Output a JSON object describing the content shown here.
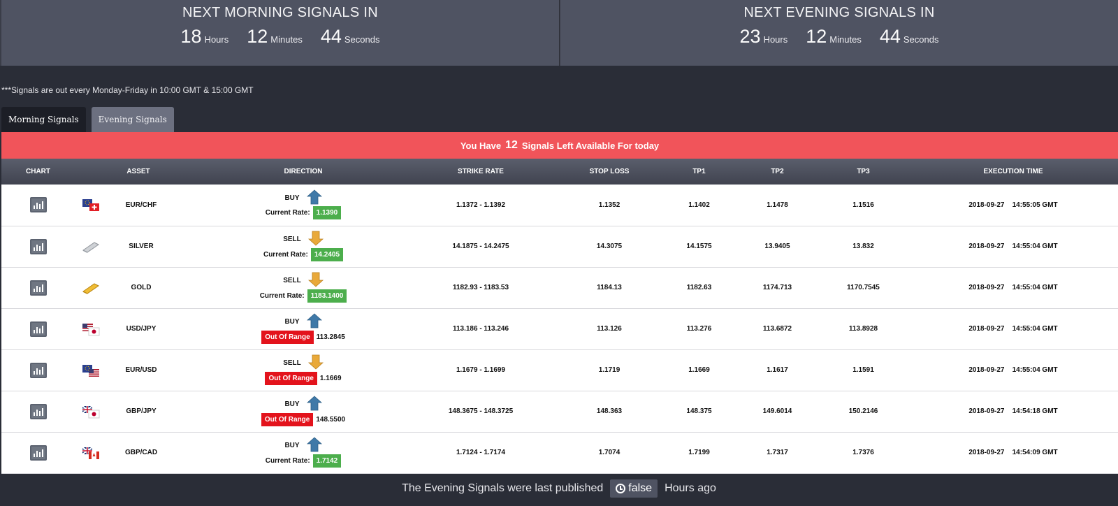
{
  "countdown": {
    "morning": {
      "title": "NEXT MORNING SIGNALS IN",
      "hours": "18",
      "hours_label": "Hours",
      "minutes": "12",
      "minutes_label": "Minutes",
      "seconds": "44",
      "seconds_label": "Seconds"
    },
    "evening": {
      "title": "NEXT EVENING SIGNALS IN",
      "hours": "23",
      "hours_label": "Hours",
      "minutes": "12",
      "minutes_label": "Minutes",
      "seconds": "44",
      "seconds_label": "Seconds"
    }
  },
  "note": "***Signals are out every Monday-Friday in 10:00 GMT & 15:00 GMT",
  "tabs": [
    {
      "label": "Morning Signals"
    },
    {
      "label": "Evening Signals"
    }
  ],
  "banner": {
    "prefix": "You Have",
    "count": "12",
    "suffix": "Signals Left Available For today"
  },
  "table": {
    "headers": [
      "CHART",
      "ASSET",
      "DIRECTION",
      "STRIKE RATE",
      "STOP LOSS",
      "TP1",
      "TP2",
      "TP3",
      "EXECUTION TIME"
    ],
    "rows": [
      {
        "asset": "EUR/CHF",
        "flag": "eur-chf-flag-icon",
        "direction": "BUY",
        "status": "current",
        "rate_label": "Current Rate:",
        "rate": "1.1390",
        "strike": "1.1372 - 1.1392",
        "stop": "1.1352",
        "tp1": "1.1402",
        "tp2": "1.1478",
        "tp3": "1.1516",
        "date": "2018-09-27",
        "time": "14:55:05 GMT"
      },
      {
        "asset": "SILVER",
        "flag": "silver-bar-icon",
        "direction": "SELL",
        "status": "current",
        "rate_label": "Current Rate:",
        "rate": "14.2405",
        "strike": "14.1875 - 14.2475",
        "stop": "14.3075",
        "tp1": "14.1575",
        "tp2": "13.9405",
        "tp3": "13.832",
        "date": "2018-09-27",
        "time": "14:55:04 GMT"
      },
      {
        "asset": "GOLD",
        "flag": "gold-bar-icon",
        "direction": "SELL",
        "status": "current",
        "rate_label": "Current Rate:",
        "rate": "1183.1400",
        "strike": "1182.93 - 1183.53",
        "stop": "1184.13",
        "tp1": "1182.63",
        "tp2": "1174.713",
        "tp3": "1170.7545",
        "date": "2018-09-27",
        "time": "14:55:04 GMT"
      },
      {
        "asset": "USD/JPY",
        "flag": "usd-jpy-flag-icon",
        "direction": "BUY",
        "status": "oor",
        "rate_label": "Out Of Range",
        "rate": "113.2845",
        "strike": "113.186 - 113.246",
        "stop": "113.126",
        "tp1": "113.276",
        "tp2": "113.6872",
        "tp3": "113.8928",
        "date": "2018-09-27",
        "time": "14:55:04 GMT"
      },
      {
        "asset": "EUR/USD",
        "flag": "eur-usd-flag-icon",
        "direction": "SELL",
        "status": "oor",
        "rate_label": "Out Of Range",
        "rate": "1.1669",
        "strike": "1.1679 - 1.1699",
        "stop": "1.1719",
        "tp1": "1.1669",
        "tp2": "1.1617",
        "tp3": "1.1591",
        "date": "2018-09-27",
        "time": "14:55:04 GMT"
      },
      {
        "asset": "GBP/JPY",
        "flag": "gbp-jpy-flag-icon",
        "direction": "BUY",
        "status": "oor",
        "rate_label": "Out Of Range",
        "rate": "148.5500",
        "strike": "148.3675 - 148.3725",
        "stop": "148.363",
        "tp1": "148.375",
        "tp2": "149.6014",
        "tp3": "150.2146",
        "date": "2018-09-27",
        "time": "14:54:18 GMT"
      },
      {
        "asset": "GBP/CAD",
        "flag": "gbp-cad-flag-icon",
        "direction": "BUY",
        "status": "current",
        "rate_label": "Current Rate:",
        "rate": "1.7142",
        "strike": "1.7124 - 1.7174",
        "stop": "1.7074",
        "tp1": "1.7199",
        "tp2": "1.7317",
        "tp3": "1.7376",
        "date": "2018-09-27",
        "time": "14:54:09 GMT"
      }
    ]
  },
  "footer": {
    "prefix": "The Evening Signals were last published",
    "value": "false",
    "suffix": "Hours ago"
  },
  "colors": {
    "buy_arrow": "#3f79a8",
    "sell_arrow": "#e9a93a",
    "banner": "#f1545a",
    "rate_badge": "#4cae4c",
    "oor_badge": "#e3131c"
  }
}
